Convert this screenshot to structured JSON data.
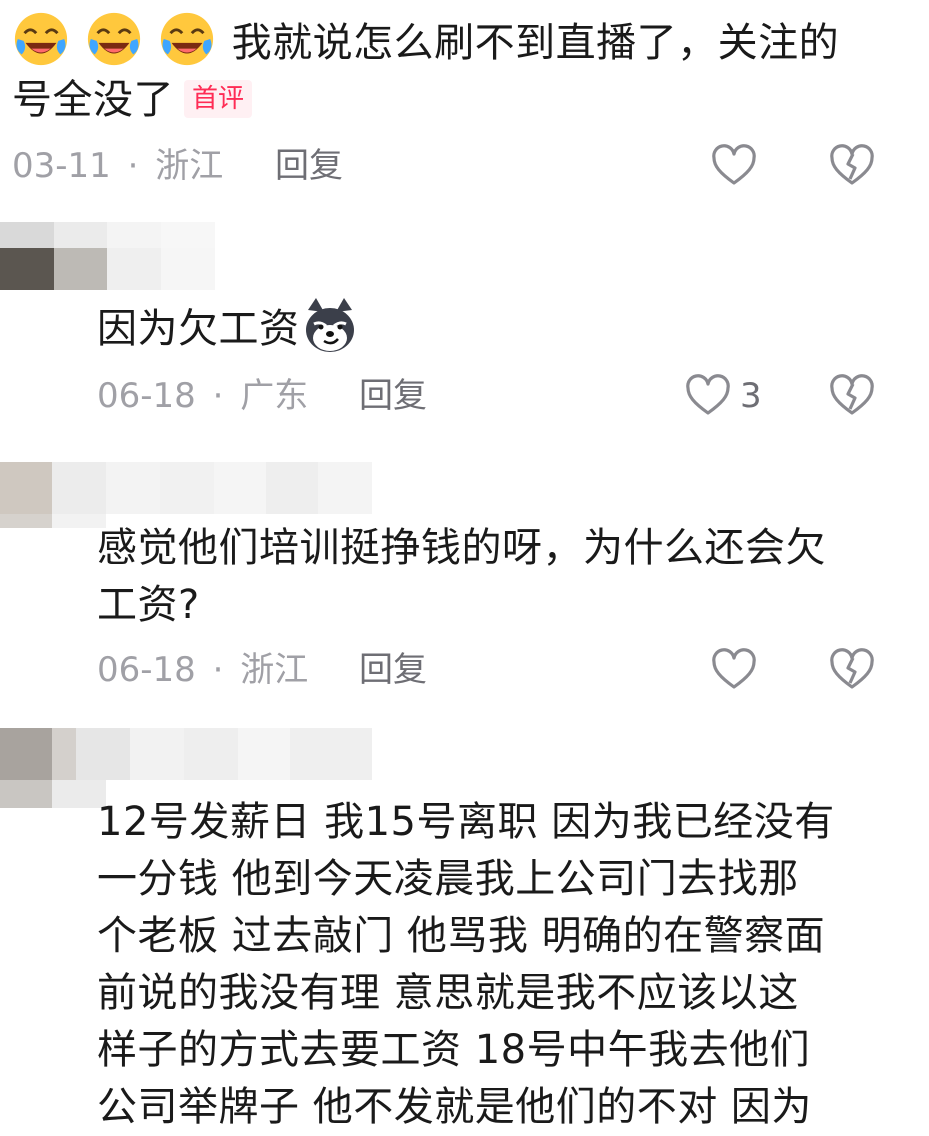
{
  "comments": [
    {
      "text_part1": "我就说怎么刷不到直播了，关注的",
      "text_part2": "号全没了",
      "badge": "首评",
      "date": "03-11",
      "separator": "·",
      "location": "浙江",
      "reply_label": "回复",
      "emoji_name": "laughing-crying-emoji",
      "emoji_count": 3
    },
    {
      "text": "因为欠工资",
      "emoji_name": "smirking-husky-emoji",
      "date": "06-18",
      "separator": "·",
      "location": "广东",
      "reply_label": "回复",
      "like_count": "3"
    },
    {
      "text_line1": "感觉他们培训挺挣钱的呀，为什么还会欠",
      "text_line2": "工资?",
      "date": "06-18",
      "separator": "·",
      "location": "浙江",
      "reply_label": "回复"
    },
    {
      "lines": [
        "12号发薪日 我15号离职 因为我已经没有",
        "一分钱 他到今天凌晨我上公司门去找那",
        "个老板 过去敲门 他骂我 明确的在警察面",
        "前说的我没有理 意思就是我不应该以这",
        "样子的方式去要工资 18号中午我去他们",
        "公司举牌子 他不发就是他们的不对 因为"
      ]
    }
  ],
  "icons": {
    "like": "heart-outline-icon",
    "dislike": "broken-heart-icon"
  },
  "colors": {
    "badge": "#ff2c55",
    "meta": "#a0a0a6",
    "text": "#1a1a1a"
  }
}
